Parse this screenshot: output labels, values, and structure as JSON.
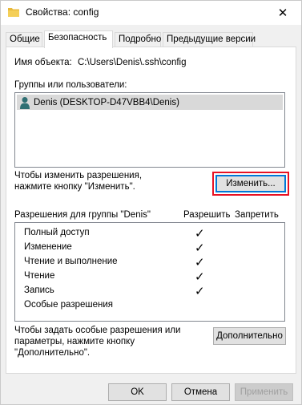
{
  "window": {
    "title": "Свойства: config",
    "close_glyph": "✕"
  },
  "tabs": [
    {
      "label": "Общие",
      "active": false
    },
    {
      "label": "Безопасность",
      "active": true
    },
    {
      "label": "Подробно",
      "active": false
    },
    {
      "label": "Предыдущие версии",
      "active": false
    }
  ],
  "security": {
    "object_label": "Имя объекта:",
    "object_path": "C:\\Users\\Denis\\.ssh\\config",
    "groups_label": "Группы или пользователи:",
    "users": [
      {
        "name": "Denis (DESKTOP-D47VBB4\\Denis)",
        "icon": "user-icon",
        "selected": true
      }
    ],
    "change_hint_line1": "Чтобы изменить разрешения,",
    "change_hint_line2": "нажмите кнопку \"Изменить\".",
    "change_button": "Изменить...",
    "permissions_for_label": "Разрешения для группы \"Denis\"",
    "allow_header": "Разрешить",
    "deny_header": "Запретить",
    "permissions": [
      {
        "name": "Полный доступ",
        "allow": true,
        "deny": false
      },
      {
        "name": "Изменение",
        "allow": true,
        "deny": false
      },
      {
        "name": "Чтение и выполнение",
        "allow": true,
        "deny": false
      },
      {
        "name": "Чтение",
        "allow": true,
        "deny": false
      },
      {
        "name": "Запись",
        "allow": true,
        "deny": false
      },
      {
        "name": "Особые разрешения",
        "allow": false,
        "deny": false
      }
    ],
    "check_glyph": "✓",
    "special_hint_line1": "Чтобы задать особые разрешения или",
    "special_hint_line2": "параметры, нажмите кнопку",
    "special_hint_line3": "\"Дополнительно\".",
    "advanced_button": "Дополнительно"
  },
  "footer": {
    "ok": "OK",
    "cancel": "Отмена",
    "apply": "Применить"
  },
  "colors": {
    "highlight": "#e81123",
    "focus": "#0078d7",
    "selection": "#d9d9d9"
  }
}
